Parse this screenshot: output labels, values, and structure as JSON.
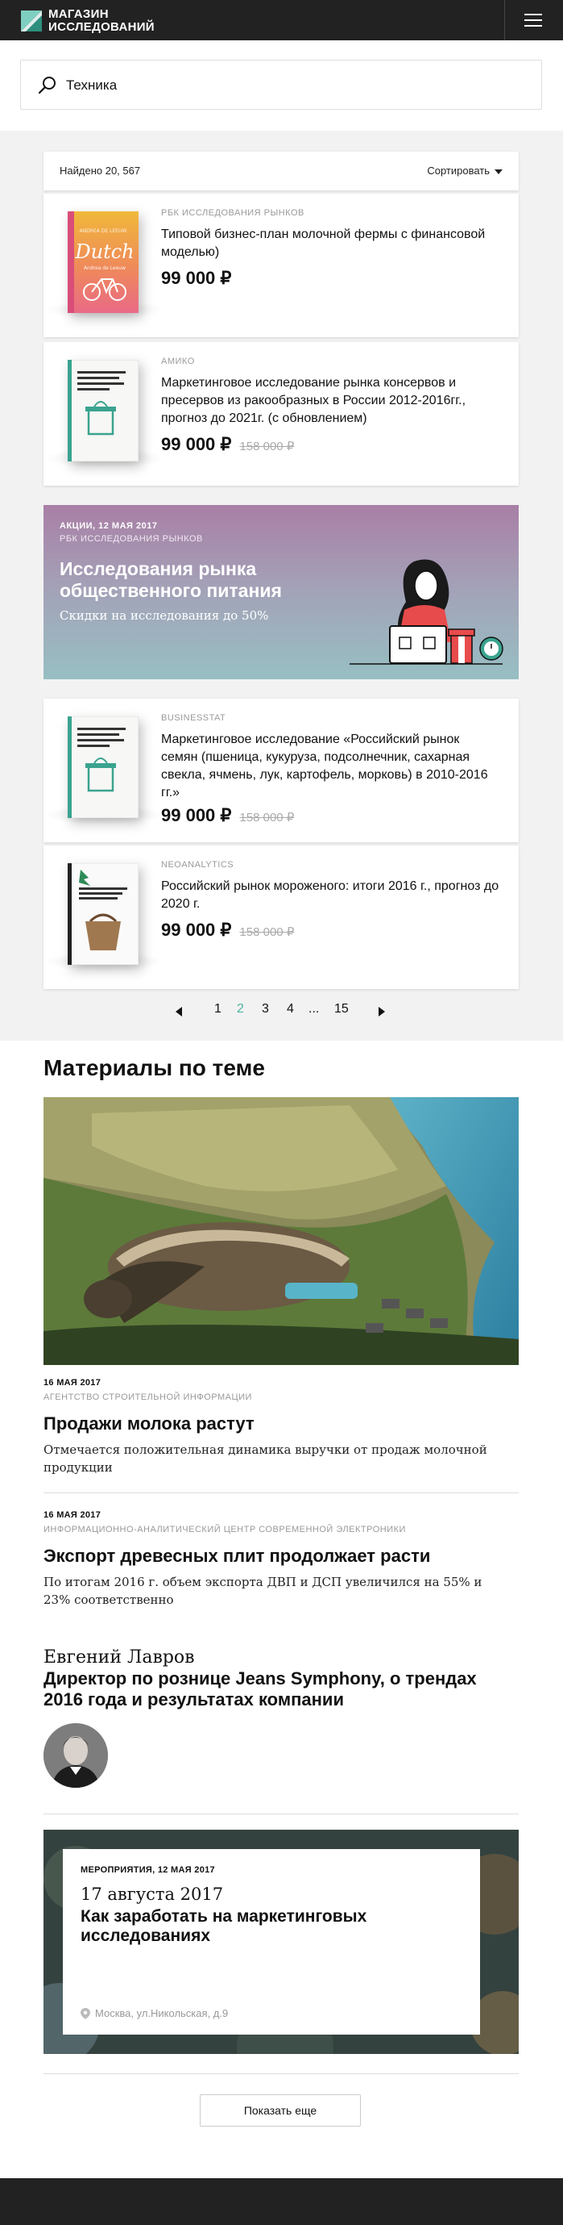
{
  "header": {
    "logo_line1": "МАГАЗИН",
    "logo_line2": "ИССЛЕДОВАНИЙ"
  },
  "search": {
    "value": "Техника",
    "placeholder": ""
  },
  "results": {
    "found_text": "Найдено 20, 567",
    "sort_label": "Сортировать"
  },
  "products": [
    {
      "source": "РБК ИССЛЕДОВАНИЯ РЫНКОВ",
      "title": "Типовой бизнес-план молочной фермы с финансовой моделью)",
      "price": "99 000 ₽",
      "old_price": "",
      "cover_word": "Dutch",
      "cover_sub": "Andrea de Leeuw"
    },
    {
      "source": "АМИКО",
      "title": "Маркетинговое исследование рынка консервов и пресервов из ракообразных в России 2012-2016гг., прогноз до 2021г. (с обновлением)",
      "price": "99 000 ₽",
      "old_price": "158 000 ₽"
    },
    {
      "source": "BUSINESSTAT",
      "title": "Маркетинговое исследование «Российский рынок семян (пшеница, кукуруза, подсолнечник, сахарная свекла, ячмень, лук, картофель, морковь) в 2010-2016 гг.»",
      "price": "99 000 ₽",
      "old_price": "158 000 ₽"
    },
    {
      "source": "NEOANALYTICS",
      "title": "Российский рынок мороженого: итоги 2016 г., прогноз до 2020 г.",
      "price": "99 000 ₽",
      "old_price": "158 000 ₽"
    }
  ],
  "promo": {
    "date": "АКЦИИ, 12 МАЯ 2017",
    "source": "РБК ИССЛЕДОВАНИЯ РЫНКОВ",
    "title": "Исследования рынка общественного питания",
    "subtitle": "Скидки на исследования до 50%"
  },
  "pagination": {
    "pages": [
      "1",
      "2",
      "3",
      "4",
      "...",
      "15"
    ],
    "active": "2"
  },
  "materials": {
    "section_title": "Материалы по теме",
    "articles": [
      {
        "date": "16 МАЯ 2017",
        "source": "АГЕНТСТВО СТРОИТЕЛЬНОЙ ИНФОРМАЦИИ",
        "title": "Продажи молока растут",
        "lead": "Отмечается положительная динамика выручки от продаж молочной продукции"
      },
      {
        "date": "16 МАЯ 2017",
        "source": "ИНФОРМАЦИОННО-АНАЛИТИЧЕСКИЙ ЦЕНТР СОВРЕМЕННОЙ ЭЛЕКТРОНИКИ",
        "title": "Экспорт древесных плит продолжает расти",
        "lead": "По итогам 2016 г. объем экспорта ДВП и ДСП увеличился на 55% и 23% соответственно"
      }
    ],
    "interview": {
      "name": "Евгений Лавров",
      "title": "Директор по рознице Jeans Symphony, о трендах 2016 года и результатах компании"
    },
    "event": {
      "kicker": "МЕРОПРИЯТИЯ, 12 МАЯ 2017",
      "date": "17 августа 2017",
      "title": "Как заработать на маркетинговых исследованиях",
      "place": "Москва, ул.Никольская, д.9"
    },
    "show_more": "Показать еще"
  },
  "colors": {
    "accent": "#4ab39f",
    "header_bg": "#222222",
    "page_bg": "#f2f2f2"
  }
}
